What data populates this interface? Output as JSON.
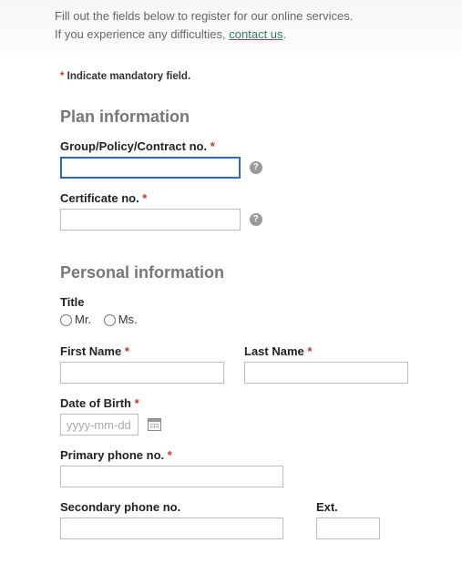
{
  "intro": {
    "line1": "Fill out the fields below to register for our online services.",
    "line2_pre": "If you experience any difficulties, ",
    "contact_link": "contact us",
    "line2_post": "."
  },
  "mandatory_note": {
    "star": "*",
    "text": " Indicate mandatory field."
  },
  "sections": {
    "plan": "Plan information",
    "personal": "Personal information"
  },
  "labels": {
    "group_no": "Group/Policy/Contract no. ",
    "cert_no": "Certificate no. ",
    "title": "Title",
    "mr": "Mr.",
    "ms": "Ms.",
    "first_name": "First Name ",
    "last_name": "Last Name ",
    "dob": "Date of Birth ",
    "primary_phone": "Primary phone no. ",
    "secondary_phone": "Secondary phone no.",
    "ext": "Ext."
  },
  "req": "*",
  "placeholders": {
    "dob": "yyyy-mm-dd"
  },
  "icons": {
    "help": "?"
  },
  "values": {
    "group_no": "",
    "cert_no": "",
    "first_name": "",
    "last_name": "",
    "dob": "",
    "primary_phone": "",
    "secondary_phone": "",
    "ext": ""
  }
}
